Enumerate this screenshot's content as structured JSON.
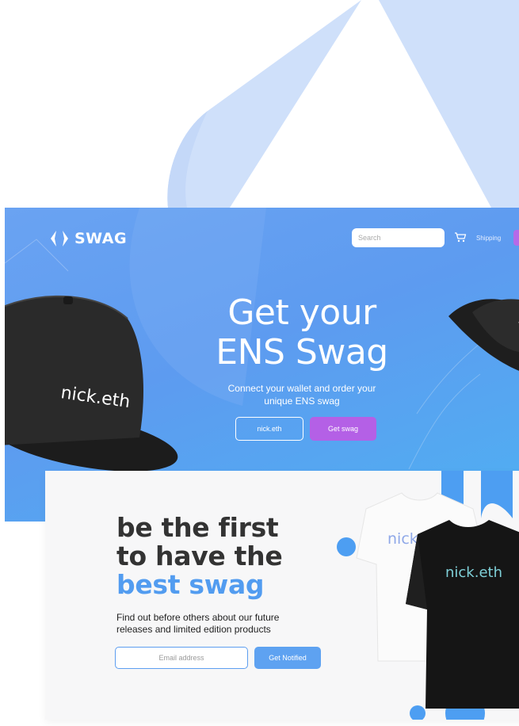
{
  "brand": {
    "name": "SWAG"
  },
  "header": {
    "search_placeholder": "Search",
    "shipping_label": "Shipping",
    "icons": {
      "logo": "ens-logo-icon",
      "cart": "cart-icon"
    }
  },
  "hero": {
    "title_line1": "Get your",
    "title_line2": "ENS Swag",
    "subtitle_line1": "Connect your wallet and order your",
    "subtitle_line2": "unique ENS swag",
    "name_button": "nick.eth",
    "cta_button": "Get swag",
    "cap_text": "nick.eth"
  },
  "notify": {
    "title_line1": "be the first",
    "title_line2": "to have the",
    "title_line3": "best swag",
    "desc_line1": "Find out before others about our future",
    "desc_line2": "releases and limited edition products",
    "email_placeholder": "Email address",
    "button": "Get Notified",
    "shirt_white_text": "nick.e",
    "shirt_black_text": "nick.eth"
  },
  "colors": {
    "brand_blue": "#5d9bf0",
    "purple": "#b460e6",
    "dark_text": "#333333"
  }
}
